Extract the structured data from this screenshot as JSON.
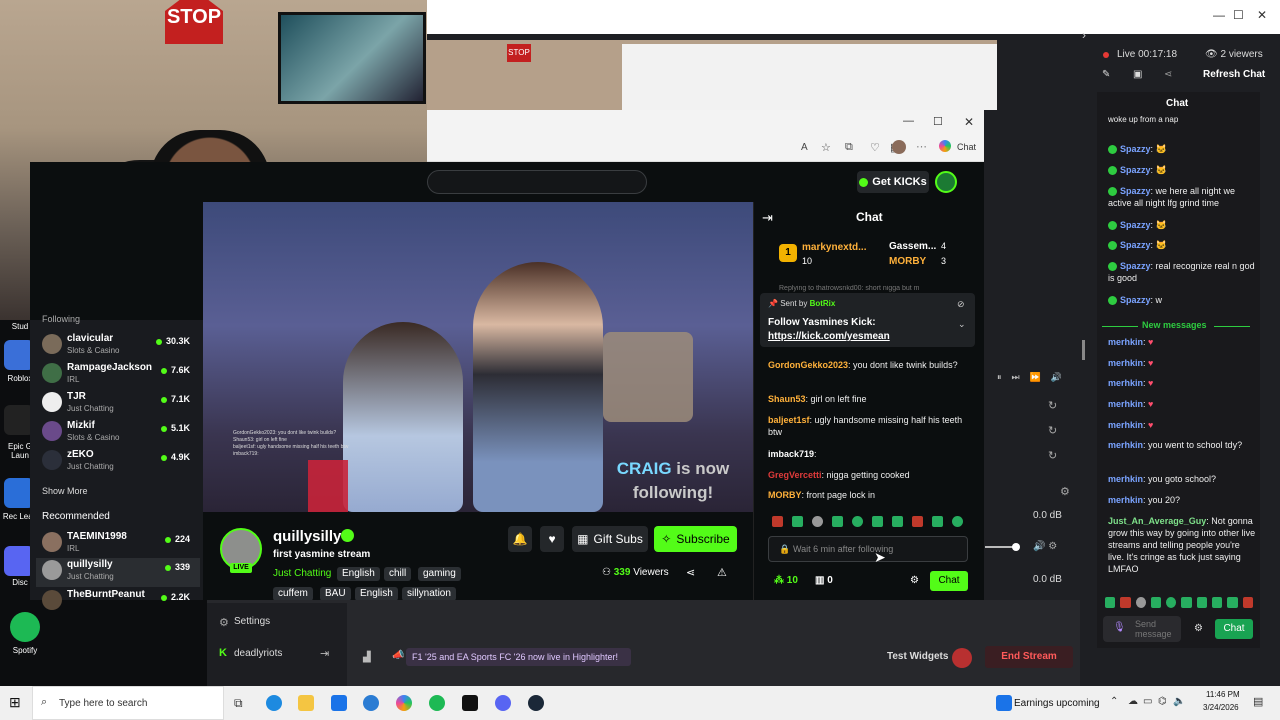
{
  "obs": {
    "live_time": "Live 00:17:18",
    "viewers": "2 viewers",
    "refresh": "Refresh Chat",
    "chat_title": "Chat",
    "new_messages": "New messages",
    "send_placeholder": "Send message",
    "chat_button": "Chat",
    "messages": [
      {
        "user": "",
        "text": "woke up from a nap"
      },
      {
        "user": "Spazzy",
        "text": ":"
      },
      {
        "user": "Spazzy",
        "text": ":"
      },
      {
        "user": "Spazzy",
        "text": ": we here all night we active all night lfg grind time"
      },
      {
        "user": "Spazzy",
        "text": ":"
      },
      {
        "user": "Spazzy",
        "text": ":"
      },
      {
        "user": "Spazzy",
        "text": ": real recognize real n god is good"
      },
      {
        "user": "Spazzy",
        "text": ": w"
      }
    ],
    "new_msgs": [
      {
        "user": "merhkin",
        "text": ":"
      },
      {
        "user": "merhkin",
        "text": ":"
      },
      {
        "user": "merhkin",
        "text": ":"
      },
      {
        "user": "merhkin",
        "text": ":"
      },
      {
        "user": "merhkin",
        "text": ":"
      },
      {
        "user": "merhkin",
        "text": ": you went to school tdy?"
      },
      {
        "user": "merhkin",
        "text": ": you goto school?"
      },
      {
        "user": "merhkin",
        "text": ": you 20?"
      },
      {
        "user": "Just_An_Average_Guy",
        "text": ": Not gonna grow this way by going into other live streams and telling people you're live. It's cringe as fuck just saying LMFAO"
      }
    ],
    "test_widgets": "Test Widgets",
    "end_stream": "End Stream",
    "highlighter": "F1 '25 and EA Sports FC '26 now live in Highlighter!",
    "settings": "Settings",
    "account": "deadlyriots",
    "db1": "0.0 dB",
    "db2": "0.0 dB"
  },
  "kick": {
    "get_kicks": "Get KICKs",
    "chat_title": "Chat",
    "leaderboard": [
      {
        "rank": "1",
        "name": "markynextd...",
        "count": "10"
      },
      {
        "name": "Gassem...",
        "count": "4"
      },
      {
        "name": "MORBY",
        "count": "3"
      }
    ],
    "pinned": {
      "sent_by_label": "Sent by",
      "sender": "BotRix",
      "title": "Follow Yasmines Kick:",
      "link": "https://kick.com/yesmean"
    },
    "replying": "Replying to thatrowsnkd00: short nigga but m",
    "messages": [
      {
        "user": "GordonGekko2023",
        "color": "#ffb13b",
        "text": ": you dont like twink builds?"
      },
      {
        "user": "Shaun53",
        "color": "#ffb13b",
        "text": ": girl on left fine"
      },
      {
        "user": "baljeet1sf",
        "color": "#ffb13b",
        "text": ": ugly handsome missing half his teeth btw"
      },
      {
        "user": "imback719",
        "color": "#ffffff",
        "text": ":"
      },
      {
        "user": "GregVercetti",
        "color": "#e03b3b",
        "text": ": nigga getting cooked"
      },
      {
        "user": "MORBY",
        "color": "#ffb13b",
        "text": ": front page lock in"
      }
    ],
    "input_placeholder": "Wait 6 min after following",
    "points": "10",
    "inventory": "0",
    "chat_button": "Chat",
    "streamer": "quillysilly",
    "stream_title": "first yasmine stream",
    "category": "Just Chatting",
    "tags_row1": [
      "English",
      "chill",
      "gaming"
    ],
    "tags_row2": [
      "cuffem",
      "BAU",
      "English",
      "sillynation"
    ],
    "gift_subs": "Gift Subs",
    "subscribe": "Subscribe",
    "viewers": "339",
    "viewers_label": "Viewers",
    "live_badge": "LIVE",
    "overlay_follow_name": "CRAIG",
    "overlay_follow_text1": "is now",
    "overlay_follow_text2": "following!",
    "sidebar": {
      "following_label": "Following",
      "following": [
        {
          "name": "clavicular",
          "cat": "Slots & Casino",
          "viewers": "30.3K"
        },
        {
          "name": "RampageJackson",
          "cat": "IRL",
          "viewers": "7.6K"
        },
        {
          "name": "TJR",
          "cat": "Just Chatting",
          "viewers": "7.1K"
        },
        {
          "name": "Mizkif",
          "cat": "Slots & Casino",
          "viewers": "5.1K"
        },
        {
          "name": "zEKO",
          "cat": "Just Chatting",
          "viewers": "4.9K"
        }
      ],
      "show_more": "Show More",
      "recommended_label": "Recommended",
      "recommended": [
        {
          "name": "TAEMIN1998",
          "cat": "IRL",
          "viewers": "224"
        },
        {
          "name": "quillysilly",
          "cat": "Just Chatting",
          "viewers": "339"
        },
        {
          "name": "TheBurntPeanut",
          "cat": "",
          "viewers": "2.2K"
        }
      ]
    }
  },
  "browser": {
    "chat_label": "Chat"
  },
  "desktop": {
    "icons": [
      "Stud",
      "Roblox",
      "Epic G Laun",
      "Rec Leag",
      "Disc",
      "Spotify"
    ]
  },
  "webcam": {
    "sign": "STOP"
  },
  "taskbar": {
    "search_placeholder": "Type here to search",
    "news": "Earnings upcoming",
    "time": "11:46 PM",
    "date": "3/24/2026"
  }
}
